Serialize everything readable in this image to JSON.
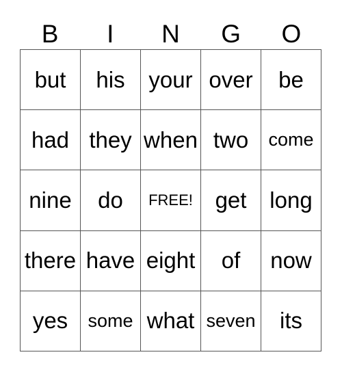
{
  "header": [
    "B",
    "I",
    "N",
    "G",
    "O"
  ],
  "rows": [
    [
      "but",
      "his",
      "your",
      "over",
      "be"
    ],
    [
      "had",
      "they",
      "when",
      "two",
      "come"
    ],
    [
      "nine",
      "do",
      "FREE!",
      "get",
      "long"
    ],
    [
      "there",
      "have",
      "eight",
      "of",
      "now"
    ],
    [
      "yes",
      "some",
      "what",
      "seven",
      "its"
    ]
  ]
}
